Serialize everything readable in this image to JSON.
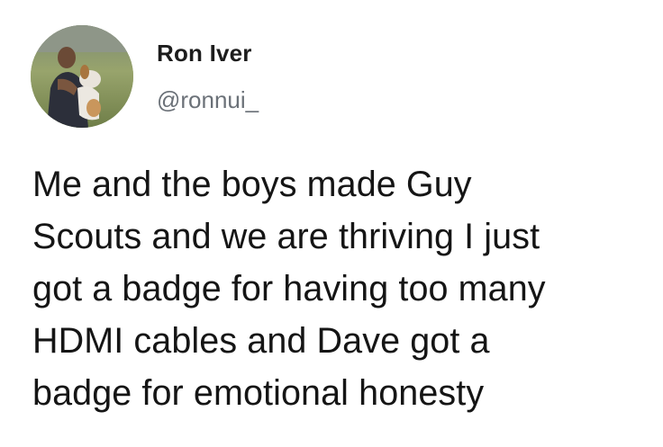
{
  "tweet": {
    "display_name": "Ron Iver",
    "handle": "@ronnui_",
    "text_lines": [
      "Me and the boys made Guy",
      "Scouts and we are thriving I just",
      "got a badge for having too many",
      "HDMI cables and Dave got a",
      "badge for emotional honesty"
    ]
  }
}
